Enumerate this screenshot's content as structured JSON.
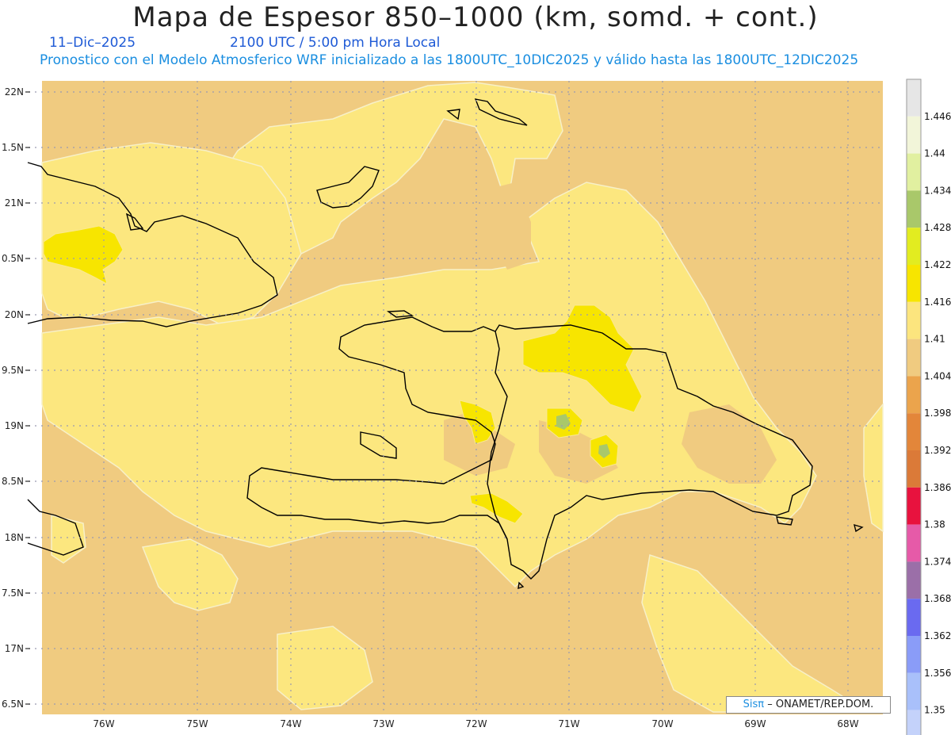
{
  "header": {
    "title": "Mapa de Espesor 850–1000 (km, somd. + cont.)",
    "date": "11–Dic–2025",
    "time": "2100 UTC / 5:00 pm Hora Local",
    "model_line": "Pronostico con el Modelo Atmosferico WRF inicializado a las 1800UTC_10DIC2025 y válido hasta las  1800UTC_12DIC2025"
  },
  "axes": {
    "lat_labels": [
      "22N",
      "1.5N",
      "21N",
      "0.5N",
      "20N",
      "9.5N",
      "19N",
      "8.5N",
      "18N",
      "7.5N",
      "17N",
      "6.5N"
    ],
    "lon_labels": [
      "76W",
      "75W",
      "74W",
      "73W",
      "72W",
      "71W",
      "70W",
      "69W",
      "68W"
    ]
  },
  "colorbar": {
    "labels": [
      "1.446",
      "1.44",
      "1.434",
      "1.428",
      "1.422",
      "1.416",
      "1.41",
      "1.404",
      "1.398",
      "1.392",
      "1.386",
      "1.38",
      "1.374",
      "1.368",
      "1.362",
      "1.356",
      "1.35"
    ],
    "colors": [
      "#e6e6e6",
      "#f2f5d9",
      "#e1f0a0",
      "#a9c86a",
      "#e2ec20",
      "#f7e500",
      "#fce57e",
      "#f0cb80",
      "#eba44c",
      "#e3863a",
      "#db7a38",
      "#e8123e",
      "#e65aa8",
      "#9b6fa8",
      "#6a6af0",
      "#8a9cf8",
      "#a9c0fa",
      "#c4d2fa"
    ]
  },
  "credit": {
    "brand": "Sisπ",
    "org": "– ONAMET/REP.DOM."
  },
  "map_colors": {
    "ocean_shade": "#f0cb80",
    "land_shade": "#fce77f",
    "high_shade": "#f7e500",
    "peak_shade": "#a9c86a",
    "coast": "#000000",
    "grid": "#9a9ab0"
  }
}
